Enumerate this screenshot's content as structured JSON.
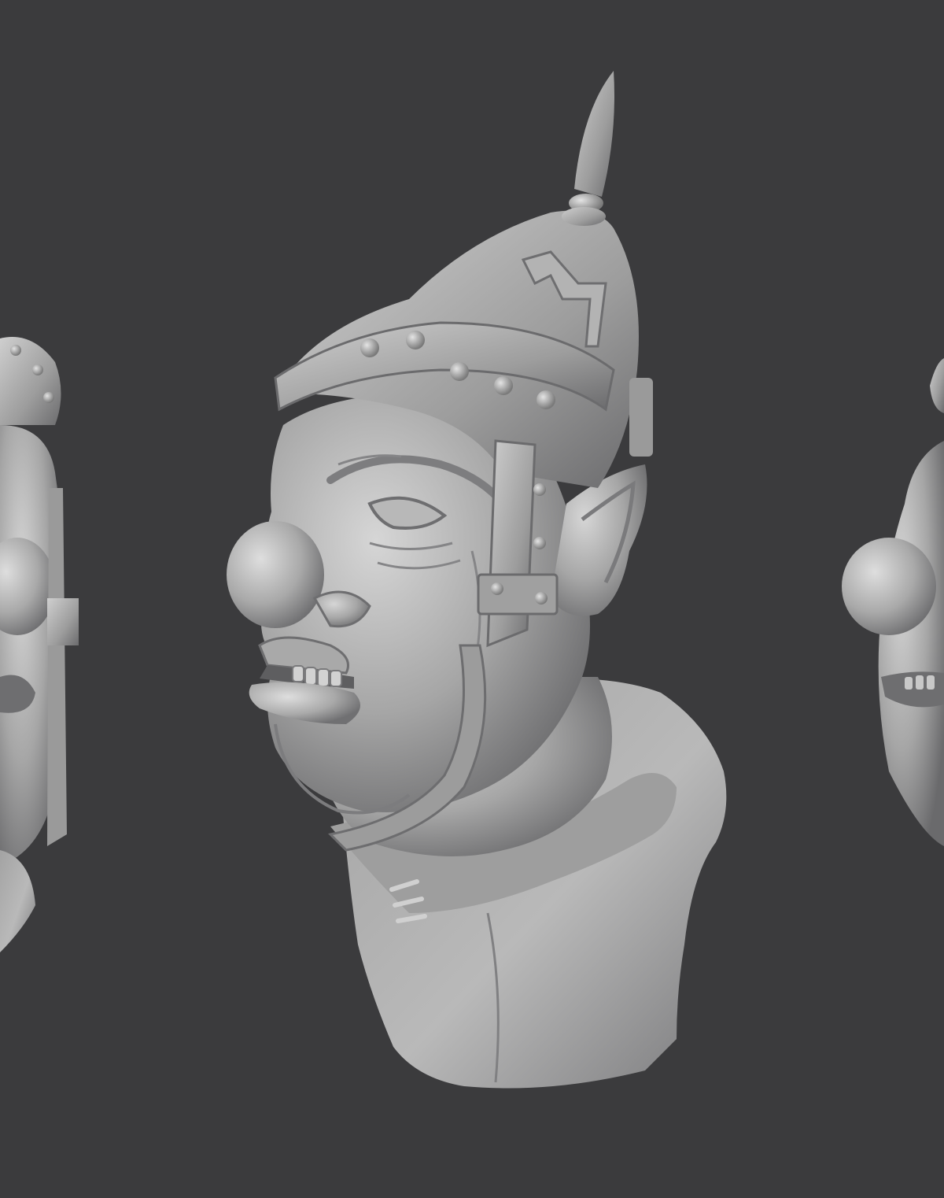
{
  "scene": {
    "background_color": "#3b3b3d",
    "clay_color": "#a8a8a8",
    "clay_shadow_color": "#6e6e70",
    "clay_highlight_color": "#d8d8d8",
    "views": [
      {
        "name": "left-partial-view",
        "subject": "helmeted-goblin-bust"
      },
      {
        "name": "center-side-view",
        "subject": "helmeted-goblin-bust"
      },
      {
        "name": "right-partial-view",
        "subject": "helmeted-goblin-bust"
      }
    ]
  }
}
